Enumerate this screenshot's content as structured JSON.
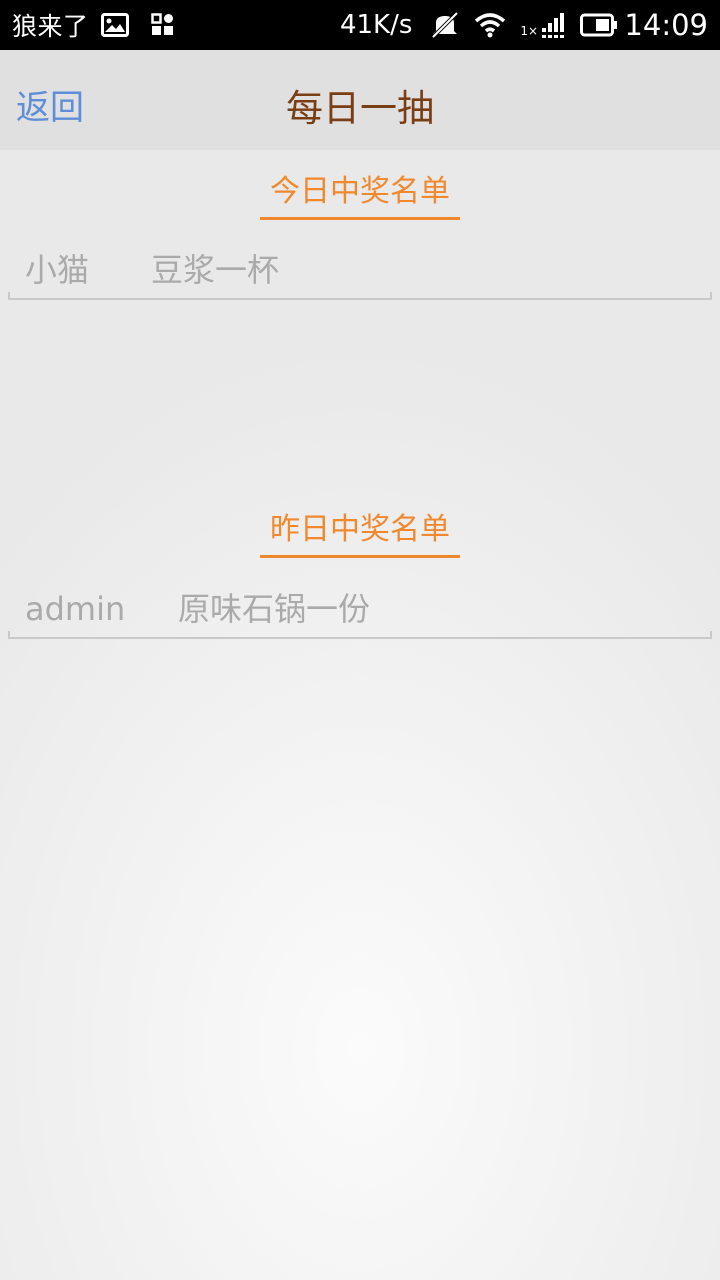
{
  "status_bar": {
    "app_name": "狼来了",
    "speed": "41K/s",
    "signal_label": "1×",
    "time": "14:09",
    "icons": [
      "image-icon",
      "apps-icon",
      "mute-icon",
      "wifi-icon",
      "signal-icon",
      "battery-icon"
    ]
  },
  "header": {
    "back_label": "返回",
    "title": "每日一抽"
  },
  "today": {
    "header": "今日中奖名单",
    "winners": [
      {
        "name": "小猫",
        "prize": "豆浆一杯"
      }
    ]
  },
  "yesterday": {
    "header": "昨日中奖名单",
    "winners": [
      {
        "name": "admin",
        "prize": "原味石锅一份"
      }
    ]
  },
  "colors": {
    "accent": "#f0882e",
    "title": "#7a3e14",
    "back": "#5f8ed8",
    "muted_text": "#aaaaaa"
  }
}
